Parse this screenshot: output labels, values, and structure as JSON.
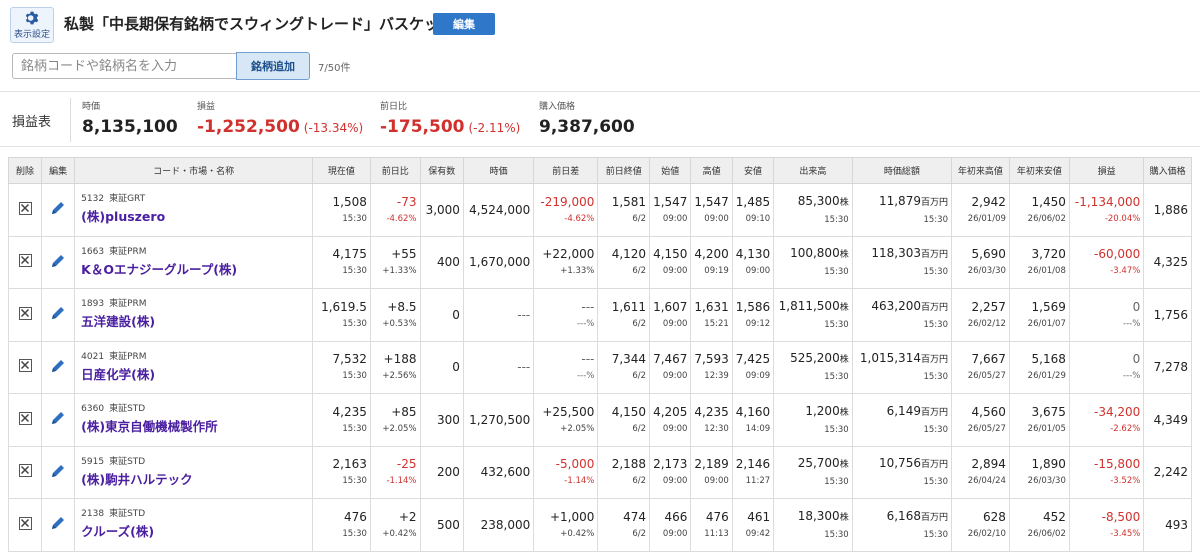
{
  "header": {
    "settings_label": "表示設定",
    "title": "私製「中長期保有銘柄でスウィングトレード」バスケット",
    "edit_label": "編集",
    "search_placeholder": "銘柄コードや銘柄名を入力",
    "add_label": "銘柄追加",
    "count": "7/50件"
  },
  "summary": {
    "label": "損益表",
    "items": [
      {
        "caption": "時価",
        "value": "8,135,100",
        "pct": ""
      },
      {
        "caption": "損益",
        "value": "-1,252,500",
        "pct": "(-13.34%)"
      },
      {
        "caption": "前日比",
        "value": "-175,500",
        "pct": "(-2.11%)"
      },
      {
        "caption": "購入価格",
        "value": "9,387,600",
        "pct": ""
      }
    ]
  },
  "table": {
    "headers": [
      "削除",
      "編集",
      "コード・市場・名称",
      "現在値",
      "前日比",
      "保有数",
      "時価",
      "前日差",
      "前日終値",
      "始値",
      "高値",
      "安値",
      "出来高",
      "時価総額",
      "年初来高値",
      "年初来安値",
      "損益",
      "購入価格"
    ],
    "rows": [
      {
        "code": "5132",
        "market": "東証GRT",
        "name": "(株)pluszero",
        "price": "1,508",
        "price_time": "15:30",
        "chg": "-73",
        "chg_pct": "-4.62%",
        "qty": "3,000",
        "mv": "4,524,000",
        "diff": "-219,000",
        "diff_pct": "-4.62%",
        "prev": "1,581",
        "prev_date": "6/2",
        "open": "1,547",
        "open_time": "09:00",
        "high": "1,547",
        "high_time": "09:00",
        "low": "1,485",
        "low_time": "09:10",
        "vol": "85,300",
        "vol_unit": "株",
        "vol_time": "15:30",
        "cap": "11,879",
        "cap_unit": "百万円",
        "cap_time": "15:30",
        "yh": "2,942",
        "yh_date": "26/01/09",
        "yl": "1,450",
        "yl_date": "26/06/02",
        "pl": "-1,134,000",
        "pl_pct": "-20.04%",
        "cost": "1,886",
        "chg_color": "red",
        "diff_color": "red",
        "pl_color": "red"
      },
      {
        "code": "1663",
        "market": "東証PRM",
        "name": "K＆Oエナジーグループ(株)",
        "price": "4,175",
        "price_time": "15:30",
        "chg": "+55",
        "chg_pct": "+1.33%",
        "qty": "400",
        "mv": "1,670,000",
        "diff": "+22,000",
        "diff_pct": "+1.33%",
        "prev": "4,120",
        "prev_date": "6/2",
        "open": "4,150",
        "open_time": "09:00",
        "high": "4,200",
        "high_time": "09:19",
        "low": "4,130",
        "low_time": "09:00",
        "vol": "100,800",
        "vol_unit": "株",
        "vol_time": "15:30",
        "cap": "118,303",
        "cap_unit": "百万円",
        "cap_time": "15:30",
        "yh": "5,690",
        "yh_date": "26/03/30",
        "yl": "3,720",
        "yl_date": "26/01/08",
        "pl": "-60,000",
        "pl_pct": "-3.47%",
        "cost": "4,325",
        "chg_color": "",
        "diff_color": "",
        "pl_color": "red"
      },
      {
        "code": "1893",
        "market": "東証PRM",
        "name": "五洋建設(株)",
        "price": "1,619.5",
        "price_time": "15:30",
        "chg": "+8.5",
        "chg_pct": "+0.53%",
        "qty": "0",
        "mv": "---",
        "diff": "---",
        "diff_pct": "---%",
        "prev": "1,611",
        "prev_date": "6/2",
        "open": "1,607",
        "open_time": "09:00",
        "high": "1,631",
        "high_time": "15:21",
        "low": "1,586",
        "low_time": "09:12",
        "vol": "1,811,500",
        "vol_unit": "株",
        "vol_time": "15:30",
        "cap": "463,200",
        "cap_unit": "百万円",
        "cap_time": "15:30",
        "yh": "2,257",
        "yh_date": "26/02/12",
        "yl": "1,569",
        "yl_date": "26/01/07",
        "pl": "0",
        "pl_pct": "---%",
        "cost": "1,756",
        "chg_color": "",
        "diff_color": "dash",
        "pl_color": "dash"
      },
      {
        "code": "4021",
        "market": "東証PRM",
        "name": "日産化学(株)",
        "price": "7,532",
        "price_time": "15:30",
        "chg": "+188",
        "chg_pct": "+2.56%",
        "qty": "0",
        "mv": "---",
        "diff": "---",
        "diff_pct": "---%",
        "prev": "7,344",
        "prev_date": "6/2",
        "open": "7,467",
        "open_time": "09:00",
        "high": "7,593",
        "high_time": "12:39",
        "low": "7,425",
        "low_time": "09:09",
        "vol": "525,200",
        "vol_unit": "株",
        "vol_time": "15:30",
        "cap": "1,015,314",
        "cap_unit": "百万円",
        "cap_time": "15:30",
        "yh": "7,667",
        "yh_date": "26/05/27",
        "yl": "5,168",
        "yl_date": "26/01/29",
        "pl": "0",
        "pl_pct": "---%",
        "cost": "7,278",
        "chg_color": "",
        "diff_color": "dash",
        "pl_color": "dash"
      },
      {
        "code": "6360",
        "market": "東証STD",
        "name": "(株)東京自働機械製作所",
        "price": "4,235",
        "price_time": "15:30",
        "chg": "+85",
        "chg_pct": "+2.05%",
        "qty": "300",
        "mv": "1,270,500",
        "diff": "+25,500",
        "diff_pct": "+2.05%",
        "prev": "4,150",
        "prev_date": "6/2",
        "open": "4,205",
        "open_time": "09:00",
        "high": "4,235",
        "high_time": "12:30",
        "low": "4,160",
        "low_time": "14:09",
        "vol": "1,200",
        "vol_unit": "株",
        "vol_time": "15:30",
        "cap": "6,149",
        "cap_unit": "百万円",
        "cap_time": "15:30",
        "yh": "4,560",
        "yh_date": "26/05/27",
        "yl": "3,675",
        "yl_date": "26/01/05",
        "pl": "-34,200",
        "pl_pct": "-2.62%",
        "cost": "4,349",
        "chg_color": "",
        "diff_color": "",
        "pl_color": "red"
      },
      {
        "code": "5915",
        "market": "東証STD",
        "name": "(株)駒井ハルテック",
        "price": "2,163",
        "price_time": "15:30",
        "chg": "-25",
        "chg_pct": "-1.14%",
        "qty": "200",
        "mv": "432,600",
        "diff": "-5,000",
        "diff_pct": "-1.14%",
        "prev": "2,188",
        "prev_date": "6/2",
        "open": "2,173",
        "open_time": "09:00",
        "high": "2,189",
        "high_time": "09:00",
        "low": "2,146",
        "low_time": "11:27",
        "vol": "25,700",
        "vol_unit": "株",
        "vol_time": "15:30",
        "cap": "10,756",
        "cap_unit": "百万円",
        "cap_time": "15:30",
        "yh": "2,894",
        "yh_date": "26/04/24",
        "yl": "1,890",
        "yl_date": "26/03/30",
        "pl": "-15,800",
        "pl_pct": "-3.52%",
        "cost": "2,242",
        "chg_color": "red",
        "diff_color": "red",
        "pl_color": "red"
      },
      {
        "code": "2138",
        "market": "東証STD",
        "name": "クルーズ(株)",
        "price": "476",
        "price_time": "15:30",
        "chg": "+2",
        "chg_pct": "+0.42%",
        "qty": "500",
        "mv": "238,000",
        "diff": "+1,000",
        "diff_pct": "+0.42%",
        "prev": "474",
        "prev_date": "6/2",
        "open": "466",
        "open_time": "09:00",
        "high": "476",
        "high_time": "11:13",
        "low": "461",
        "low_time": "09:42",
        "vol": "18,300",
        "vol_unit": "株",
        "vol_time": "15:30",
        "cap": "6,168",
        "cap_unit": "百万円",
        "cap_time": "15:30",
        "yh": "628",
        "yh_date": "26/02/10",
        "yl": "452",
        "yl_date": "26/06/02",
        "pl": "-8,500",
        "pl_pct": "-3.45%",
        "cost": "493",
        "chg_color": "",
        "diff_color": "",
        "pl_color": "red"
      }
    ]
  },
  "colors": {
    "red": "#d0312d",
    "accent": "#2f78c9",
    "name": "#4a1fa0"
  }
}
